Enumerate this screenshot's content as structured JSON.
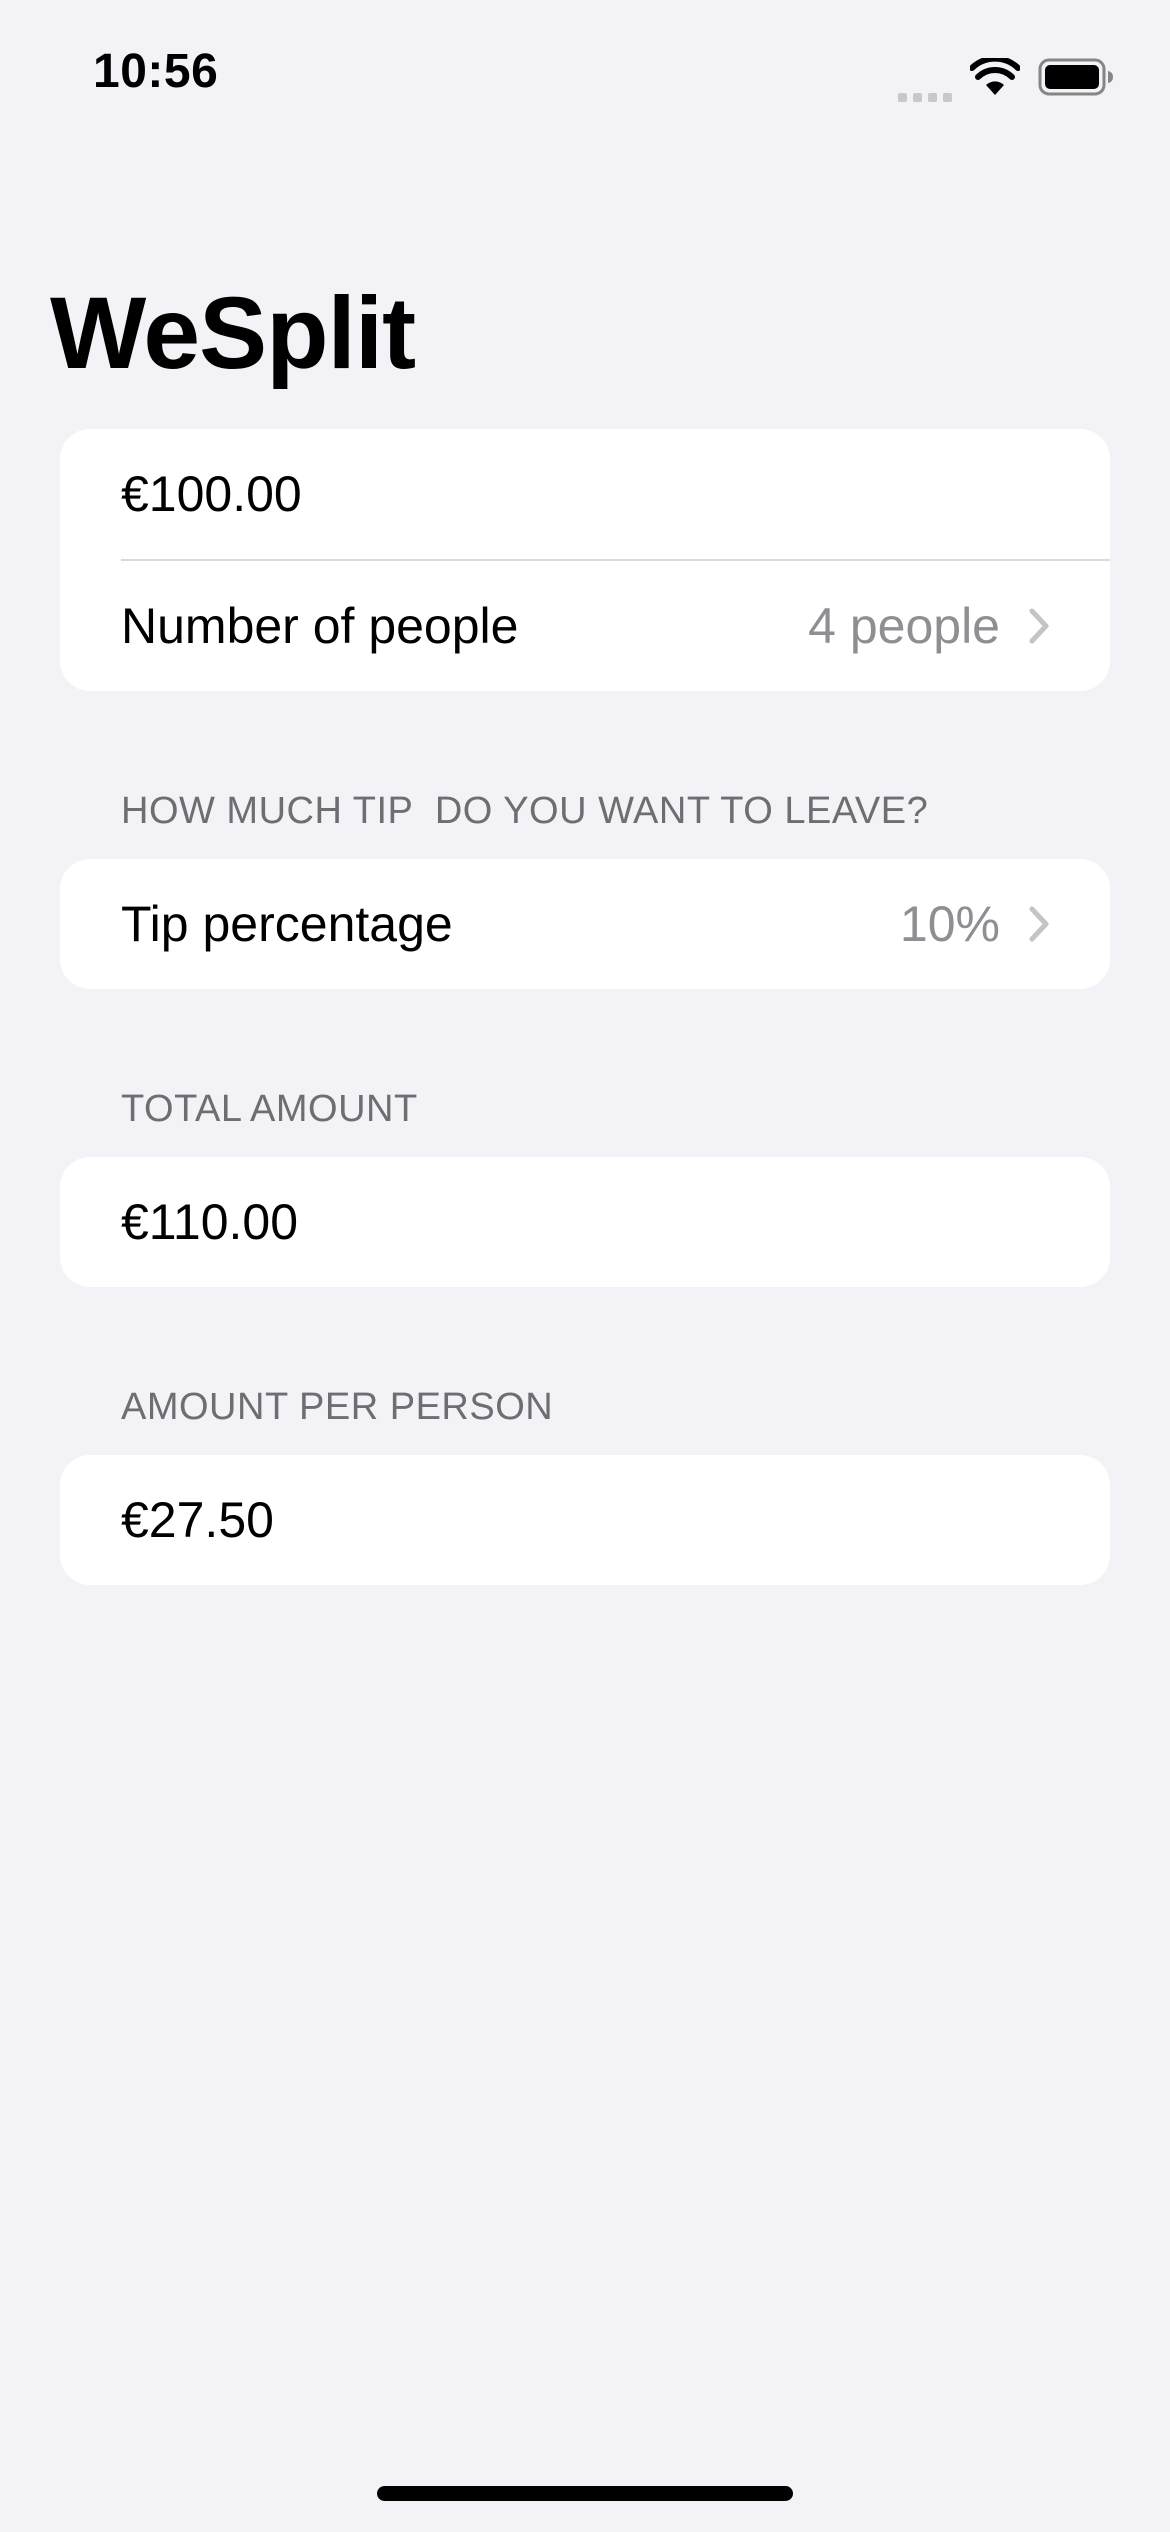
{
  "status": {
    "time": "10:56",
    "icons": [
      "cellular-signal-icon",
      "wifi-icon",
      "battery-icon"
    ]
  },
  "nav": {
    "title": "WeSplit"
  },
  "form": {
    "amount_value": "€100.00",
    "people_label": "Number of people",
    "people_value": "4 people",
    "tip_header": "HOW MUCH TIP  DO YOU WANT TO LEAVE?",
    "tip_label": "Tip percentage",
    "tip_value": "10%",
    "total_header": "TOTAL AMOUNT",
    "total_value": "€110.00",
    "per_person_header": "AMOUNT PER PERSON",
    "per_person_value": "€27.50"
  },
  "colors": {
    "background": "#f2f2f7",
    "card": "#ffffff",
    "secondary_text": "#8e8e93",
    "section_header_text": "#6d6d72",
    "chevron": "#c4c4c7"
  }
}
